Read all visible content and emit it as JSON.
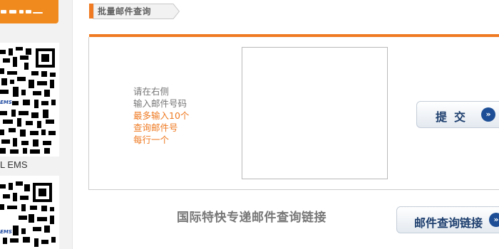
{
  "sidebar": {
    "qr_codes": [
      {
        "badge": "EMS",
        "caption": "L EMS"
      },
      {
        "badge": "EMS"
      }
    ]
  },
  "section": {
    "title": "批量邮件查询"
  },
  "instructions": {
    "line1": "请在右侧",
    "line2": "输入邮件号码",
    "line3": "最多输入10个",
    "line4": "查询邮件号",
    "line5": "每行一个"
  },
  "tracking_input": {
    "value": ""
  },
  "submit": {
    "label": "提交"
  },
  "links": {
    "title": "国际特快专递邮件查询链接",
    "button_label": "邮件查询链接"
  },
  "colors": {
    "accent": "#ef7a22",
    "button_text": "#1d3e6e",
    "arrow_icon": "#1e4f96"
  }
}
